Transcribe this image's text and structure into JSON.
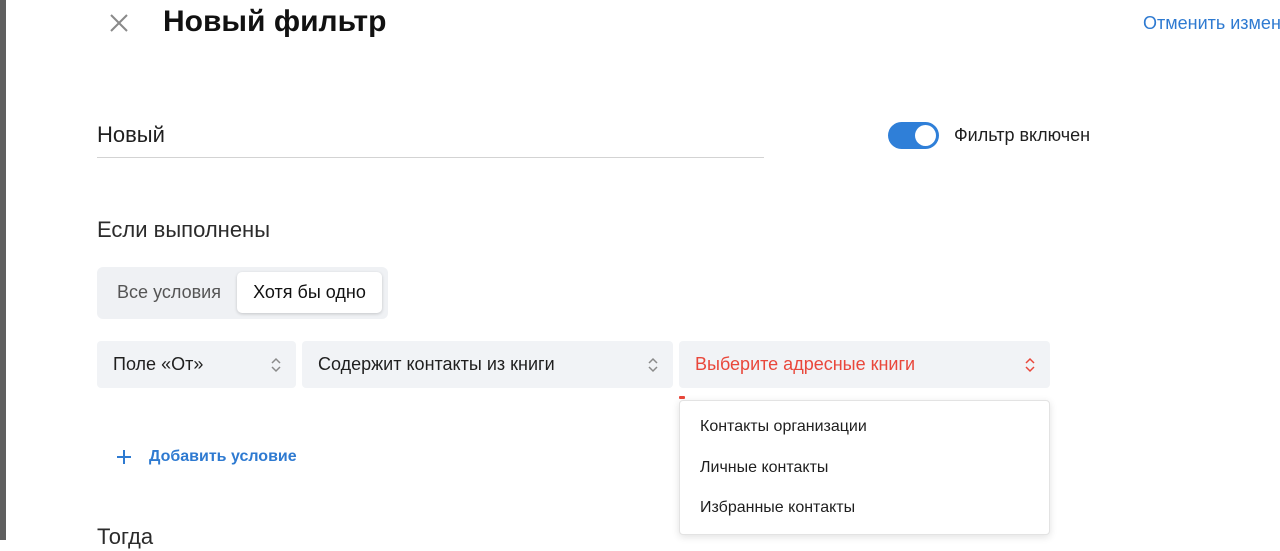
{
  "header": {
    "title": "Новый фильтр",
    "cancel_label": "Отменить измен"
  },
  "filter": {
    "name_value": "Новый",
    "enabled": true,
    "toggle_label": "Фильтр включен"
  },
  "conditions": {
    "section_title": "Если выполнены",
    "mode_options": [
      "Все условия",
      "Хотя бы одно"
    ],
    "selected_mode": "Хотя бы одно",
    "rule": {
      "field": "Поле «От»",
      "operator": "Содержит контакты из книги",
      "value_placeholder": "Выберите адресные книги"
    },
    "dropdown_options": [
      "Контакты организации",
      "Личные контакты",
      "Избранные контакты"
    ],
    "add_condition_label": "Добавить условие"
  },
  "actions": {
    "section_title": "Тогда"
  },
  "colors": {
    "accent": "#2f7fd8",
    "link": "#2e7ad1",
    "error": "#e9473b"
  }
}
